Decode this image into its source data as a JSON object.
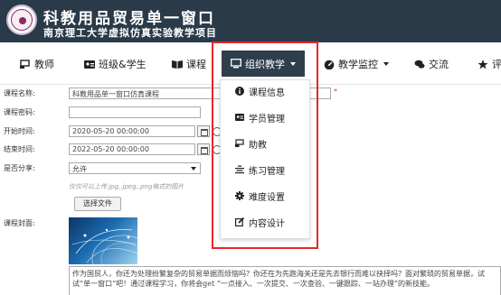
{
  "header": {
    "title": "科教用品贸易单一窗口",
    "subtitle": "南京理工大学虚拟仿真实验教学项目"
  },
  "nav": {
    "items": [
      {
        "label": "教师",
        "icon": "teacher-icon"
      },
      {
        "label": "班级&学生",
        "icon": "id-card-icon"
      },
      {
        "label": "课程",
        "icon": "book-icon"
      },
      {
        "label": "组织教学",
        "icon": "monitor-icon",
        "active": true
      },
      {
        "label": "教学监控",
        "icon": "dashboard-icon"
      },
      {
        "label": "交流",
        "icon": "comments-icon"
      },
      {
        "label": "评",
        "icon": "star-icon"
      }
    ]
  },
  "dropdown": {
    "items": [
      {
        "label": "课程信息",
        "icon": "info-icon"
      },
      {
        "label": "学员管理",
        "icon": "id-card-icon"
      },
      {
        "label": "助教",
        "icon": "teacher-icon"
      },
      {
        "label": "练习管理",
        "icon": "list-icon"
      },
      {
        "label": "难度设置",
        "icon": "gear-icon"
      },
      {
        "label": "内容设计",
        "icon": "edit-icon"
      }
    ]
  },
  "form": {
    "course_name_label": "课程名称:",
    "course_name_value": "科教用品单一窗口仿真课程",
    "required_mark": "*",
    "course_password_label": "课程密码:",
    "course_password_value": "",
    "start_time_label": "开始时间:",
    "start_time_value": "2020-05-20 00:00:00",
    "end_time_label": "结束时间:",
    "end_time_value": "2022-05-20 00:00:00",
    "share_label": "是否分享:",
    "share_value": "允许",
    "upload_hint": "仅仅可以上传.jpg,.jpeg,.png格式的图片",
    "upload_button": "选择文件",
    "cover_label": "课程封面:",
    "description": "作为国贸人，你还为处理纷繁复杂的贸易单据而烦恼吗？你还在为先跑海关还是先去银行而难以抉择吗？面对繁琐的贸易单据，试试“单一窗口”吧！通过课程学习，你将会get “一点接入、一次提交、一次查验、一键跟踪、一站办理”的新技能。"
  },
  "colors": {
    "header_bg": "#2a3a48",
    "active_nav_bg": "#2f3e4d",
    "highlight_border": "#e8262b"
  }
}
